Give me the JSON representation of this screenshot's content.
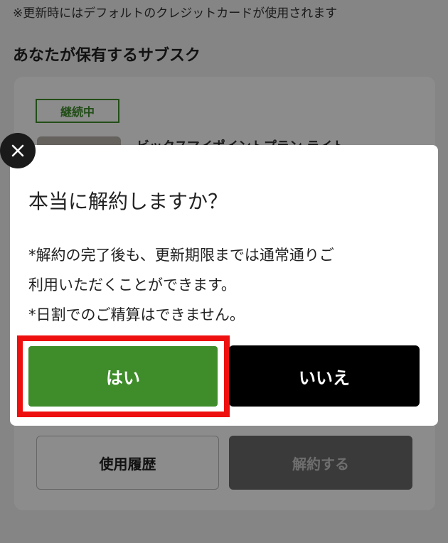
{
  "page": {
    "notice": "※更新時にはデフォルトのクレジットカードが使用されます",
    "section_title": "あなたが保有するサブスク",
    "subscription": {
      "status_badge": "継続中",
      "plan_name": "ビックスマイポイントプラン ライト"
    },
    "buttons": {
      "history": "使用履歴",
      "cancel": "解約する"
    }
  },
  "dialog": {
    "title": "本当に解約しますか？",
    "message_lines": [
      "*解約の完了後も、更新期限までは通常通りご",
      "利用いただくことができます。",
      "*日割でのご精算はできません。"
    ],
    "yes_label": "はい",
    "no_label": "いいえ",
    "close_icon": "close-icon"
  },
  "colors": {
    "primary_green": "#3e8c2a",
    "highlight_red": "#ee0f0f",
    "dark_button": "#000000"
  }
}
